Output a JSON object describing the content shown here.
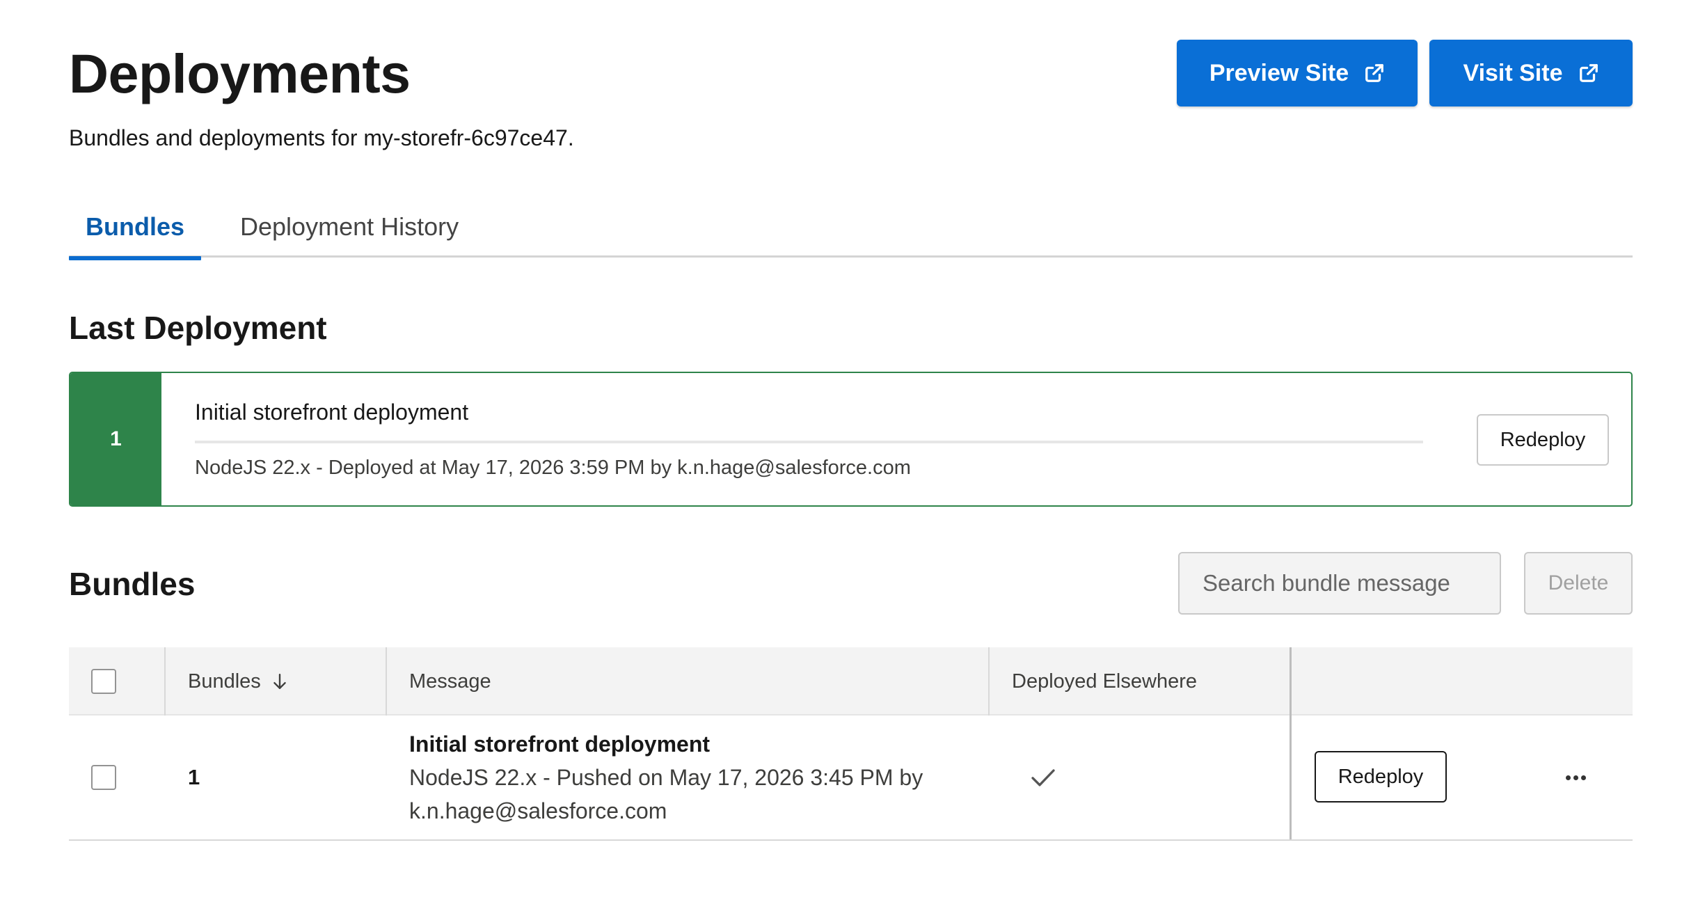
{
  "header": {
    "title": "Deployments",
    "subtitle": "Bundles and deployments for my-storefr-6c97ce47.",
    "preview_label": "Preview Site",
    "visit_label": "Visit Site"
  },
  "tabs": [
    {
      "label": "Bundles",
      "active": true
    },
    {
      "label": "Deployment History",
      "active": false
    }
  ],
  "last_deployment": {
    "heading": "Last Deployment",
    "number": "1",
    "message": "Initial storefront deployment",
    "meta": "NodeJS 22.x - Deployed at May 17, 2026 3:59 PM by k.n.hage@salesforce.com",
    "redeploy_label": "Redeploy",
    "status_color": "#2e844a"
  },
  "bundles": {
    "heading": "Bundles",
    "search_placeholder": "Search bundle message",
    "delete_label": "Delete",
    "columns": [
      "Bundles",
      "Message",
      "Deployed Elsewhere"
    ],
    "rows": [
      {
        "number": "1",
        "message_title": "Initial storefront deployment",
        "message_line1": "NodeJS 22.x - Pushed on May 17, 2026 3:45 PM by",
        "message_line2": "k.n.hage@salesforce.com",
        "deployed_elsewhere": true,
        "redeploy_label": "Redeploy"
      }
    ]
  },
  "icons": {
    "external_link": "external-link-icon",
    "search": "search-icon",
    "sort": "arrow-down-icon",
    "check": "check-icon",
    "more": "more-actions-icon"
  },
  "colors": {
    "brand": "#0a6fd6",
    "active_tab": "#0b5cab",
    "success": "#2e844a"
  }
}
